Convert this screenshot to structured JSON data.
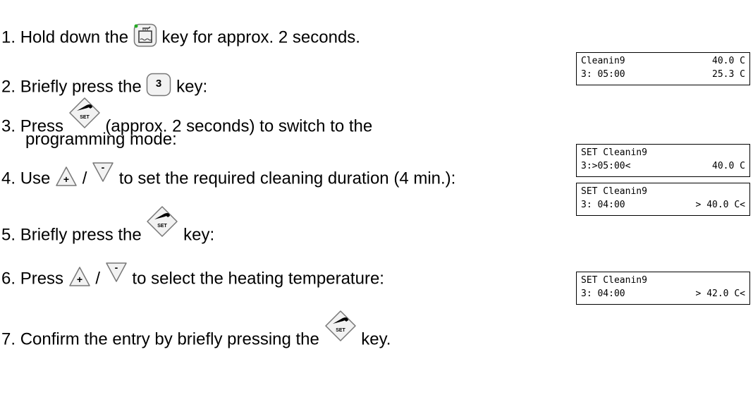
{
  "steps": [
    {
      "num": "1.",
      "before": "Hold down the",
      "after": "key for approx. 2 seconds.",
      "icon": "cleaning-key-icon"
    },
    {
      "num": "2.",
      "before": "Briefly press the",
      "after": "key:",
      "icon": "key-3-icon",
      "key_label": "3"
    },
    {
      "num": "3.",
      "before": "Press",
      "after": "(approx. 2 seconds) to switch to the",
      "line2": "programming mode:",
      "icon": "set-wrench-icon",
      "key_label": "SET"
    },
    {
      "num": "4.",
      "before": "Use",
      "sep": "/",
      "after": "to set the required cleaning duration (4 min.):",
      "icon": "plus-minus-icons"
    },
    {
      "num": "5.",
      "before": "Briefly press the",
      "after": "key:",
      "icon": "set-wrench-icon",
      "key_label": "SET"
    },
    {
      "num": "6.",
      "before": "Press",
      "sep": "/",
      "after": "to select the heating temperature:",
      "icon": "plus-minus-icons"
    },
    {
      "num": "7.",
      "before": "Confirm the entry by briefly pressing the",
      "after": "key.",
      "icon": "set-wrench-icon",
      "key_label": "SET"
    }
  ],
  "plus_label": "+",
  "minus_label": "-",
  "displays": [
    {
      "line1_left": "Cleanin9",
      "line1_right": "40.0 C",
      "line2_left": "3: 05:00",
      "line2_right": "25.3 C"
    },
    {
      "line1_left": "SET Cleanin9",
      "line1_right": "",
      "line2_left": "3:>05:00<",
      "line2_right": "40.0 C"
    },
    {
      "line1_left": "SET Cleanin9",
      "line1_right": "",
      "line2_left": "3: 04:00",
      "line2_right": "> 40.0 C<"
    },
    {
      "line1_left": "SET Cleanin9",
      "line1_right": "",
      "line2_left": "3: 04:00",
      "line2_right": "> 42.0 C<"
    }
  ]
}
